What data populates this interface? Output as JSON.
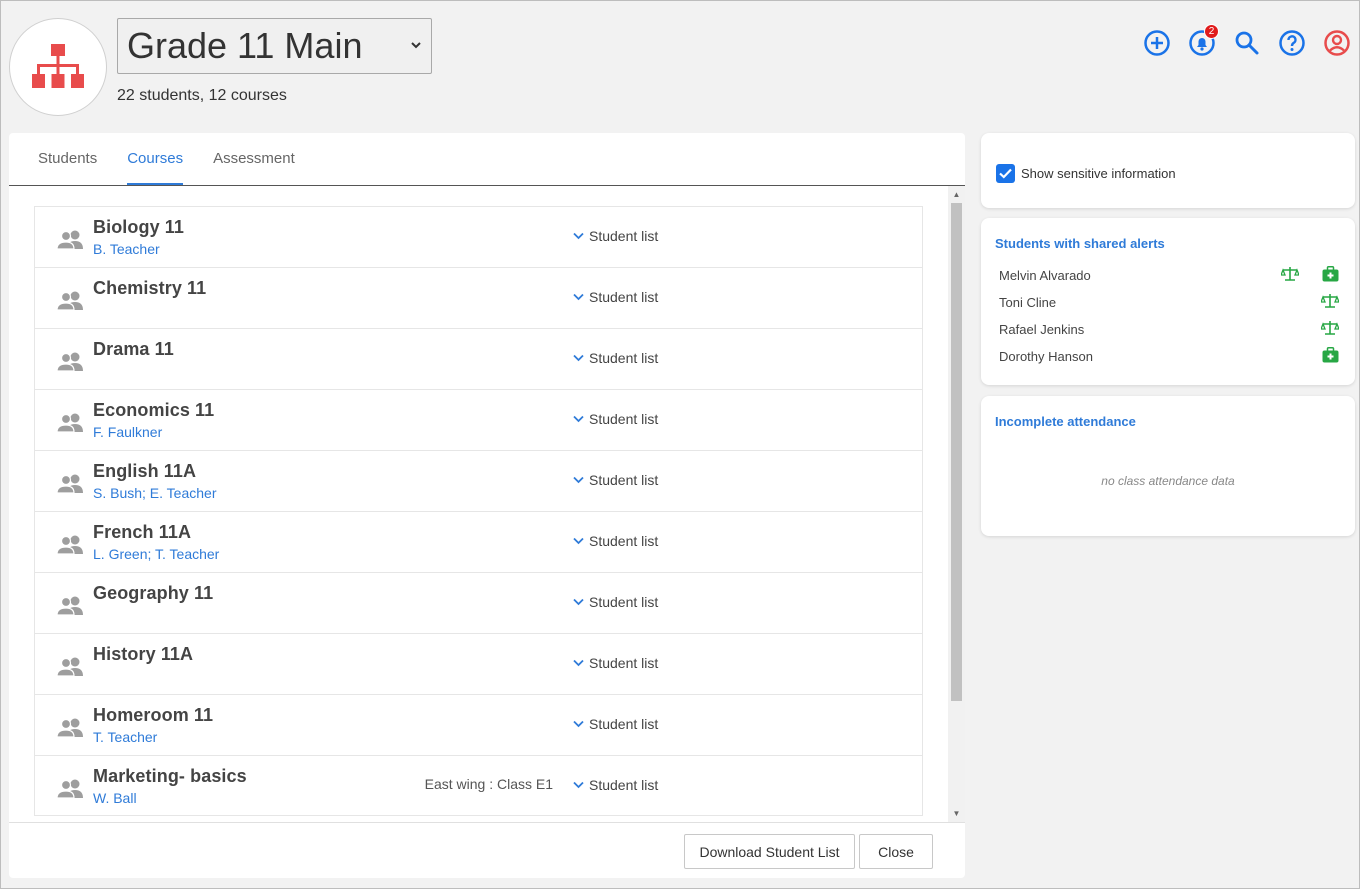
{
  "header": {
    "group_name": "Grade 11 Main",
    "summary": "22 students, 12 courses",
    "notification_count": "2",
    "logo_color": "#e84c4c",
    "icon_color": "#1a73e8"
  },
  "tabs": [
    {
      "label": "Students",
      "active": false
    },
    {
      "label": "Courses",
      "active": true
    },
    {
      "label": "Assessment",
      "active": false
    }
  ],
  "courses": [
    {
      "name": "Biology 11",
      "teacher": "B. Teacher",
      "room": "",
      "action": "Student list"
    },
    {
      "name": "Chemistry 11",
      "teacher": "",
      "room": "",
      "action": "Student list"
    },
    {
      "name": "Drama 11",
      "teacher": "",
      "room": "",
      "action": "Student list"
    },
    {
      "name": "Economics 11",
      "teacher": "F. Faulkner",
      "room": "",
      "action": "Student list"
    },
    {
      "name": "English 11A",
      "teacher": "S. Bush; E. Teacher",
      "room": "",
      "action": "Student list"
    },
    {
      "name": "French 11A",
      "teacher": "L. Green; T. Teacher",
      "room": "",
      "action": "Student list"
    },
    {
      "name": "Geography 11",
      "teacher": "",
      "room": "",
      "action": "Student list"
    },
    {
      "name": "History 11A",
      "teacher": "",
      "room": "",
      "action": "Student list"
    },
    {
      "name": "Homeroom 11",
      "teacher": "T. Teacher",
      "room": "",
      "action": "Student list"
    },
    {
      "name": "Marketing- basics",
      "teacher": "W. Ball",
      "room": "East wing : Class E1",
      "action": "Student list"
    }
  ],
  "footer": {
    "download_label": "Download Student List",
    "close_label": "Close"
  },
  "sensitive": {
    "label": "Show sensitive information",
    "checked": true
  },
  "alerts": {
    "title": "Students with shared alerts",
    "students": [
      {
        "name": "Melvin Alvarado",
        "icons": [
          "scale-icon",
          "medical-icon"
        ]
      },
      {
        "name": "Toni Cline",
        "icons": [
          "scale-icon"
        ]
      },
      {
        "name": "Rafael Jenkins",
        "icons": [
          "scale-icon"
        ]
      },
      {
        "name": "Dorothy Hanson",
        "icons": [
          "medical-icon"
        ]
      }
    ],
    "icon_color": "#27a744"
  },
  "attendance": {
    "title": "Incomplete attendance",
    "empty_text": "no class attendance data"
  }
}
